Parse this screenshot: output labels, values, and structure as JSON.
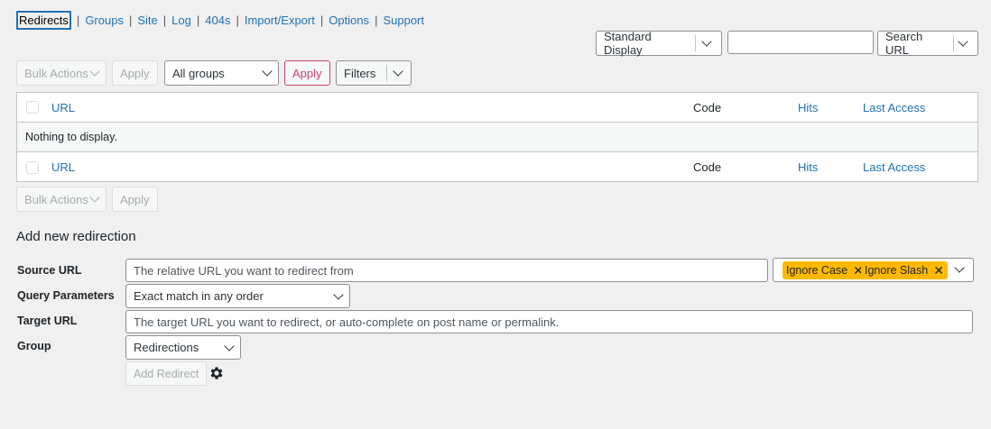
{
  "subnav": {
    "tabs": [
      {
        "label": "Redirects",
        "current": true
      },
      {
        "label": "Groups"
      },
      {
        "label": "Site"
      },
      {
        "label": "Log"
      },
      {
        "label": "404s"
      },
      {
        "label": "Import/Export"
      },
      {
        "label": "Options"
      },
      {
        "label": "Support"
      }
    ],
    "separator": "|"
  },
  "search": {
    "display_select": "Standard Display",
    "search_value": "",
    "search_type": "Search URL"
  },
  "tablenav_top": {
    "bulk_actions": "Bulk Actions",
    "apply": "Apply",
    "group_filter": "All groups",
    "apply_filter": "Apply",
    "filters": "Filters"
  },
  "table": {
    "columns": {
      "url": "URL",
      "code": "Code",
      "hits": "Hits",
      "last_access": "Last Access"
    },
    "empty_message": "Nothing to display."
  },
  "tablenav_bottom": {
    "bulk_actions": "Bulk Actions",
    "apply": "Apply"
  },
  "form": {
    "title": "Add new redirection",
    "source_label": "Source URL",
    "source_placeholder": "The relative URL you want to redirect from",
    "flags": [
      "Ignore Case",
      "Ignore Slash"
    ],
    "query_label": "Query Parameters",
    "query_value": "Exact match in any order",
    "target_label": "Target URL",
    "target_placeholder": "The target URL you want to redirect, or auto-complete on post name or permalink.",
    "group_label": "Group",
    "group_value": "Redirections",
    "add_button": "Add Redirect"
  },
  "icons": {
    "remove_flag": "close-icon",
    "settings": "gear-icon",
    "dropdown": "chevron-down-icon"
  },
  "colors": {
    "link": "#2271b1",
    "chip": "#ffb900",
    "apply_accent": "#c3446c"
  }
}
